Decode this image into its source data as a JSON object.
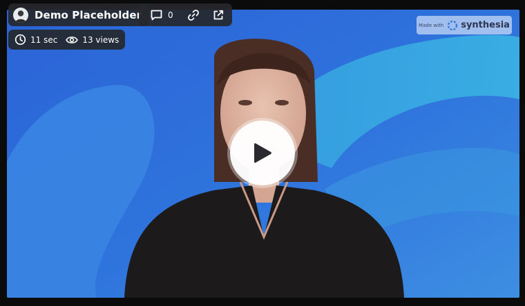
{
  "video": {
    "title": "Demo Placeholder",
    "comment_count": "0",
    "duration": "11 sec",
    "views": "13 views"
  },
  "watermark": {
    "prefix": "Made with",
    "brand": "synthesia"
  },
  "icons": {
    "avatar": "avatar-icon",
    "comment": "comment-icon",
    "link": "link-icon",
    "external": "external-link-icon",
    "clock": "clock-icon",
    "eye": "eye-icon",
    "play": "play-icon"
  },
  "colors": {
    "background_blue": "#2f6fd8",
    "pill_bg": "#26282c",
    "frame": "#0b0b0c"
  }
}
